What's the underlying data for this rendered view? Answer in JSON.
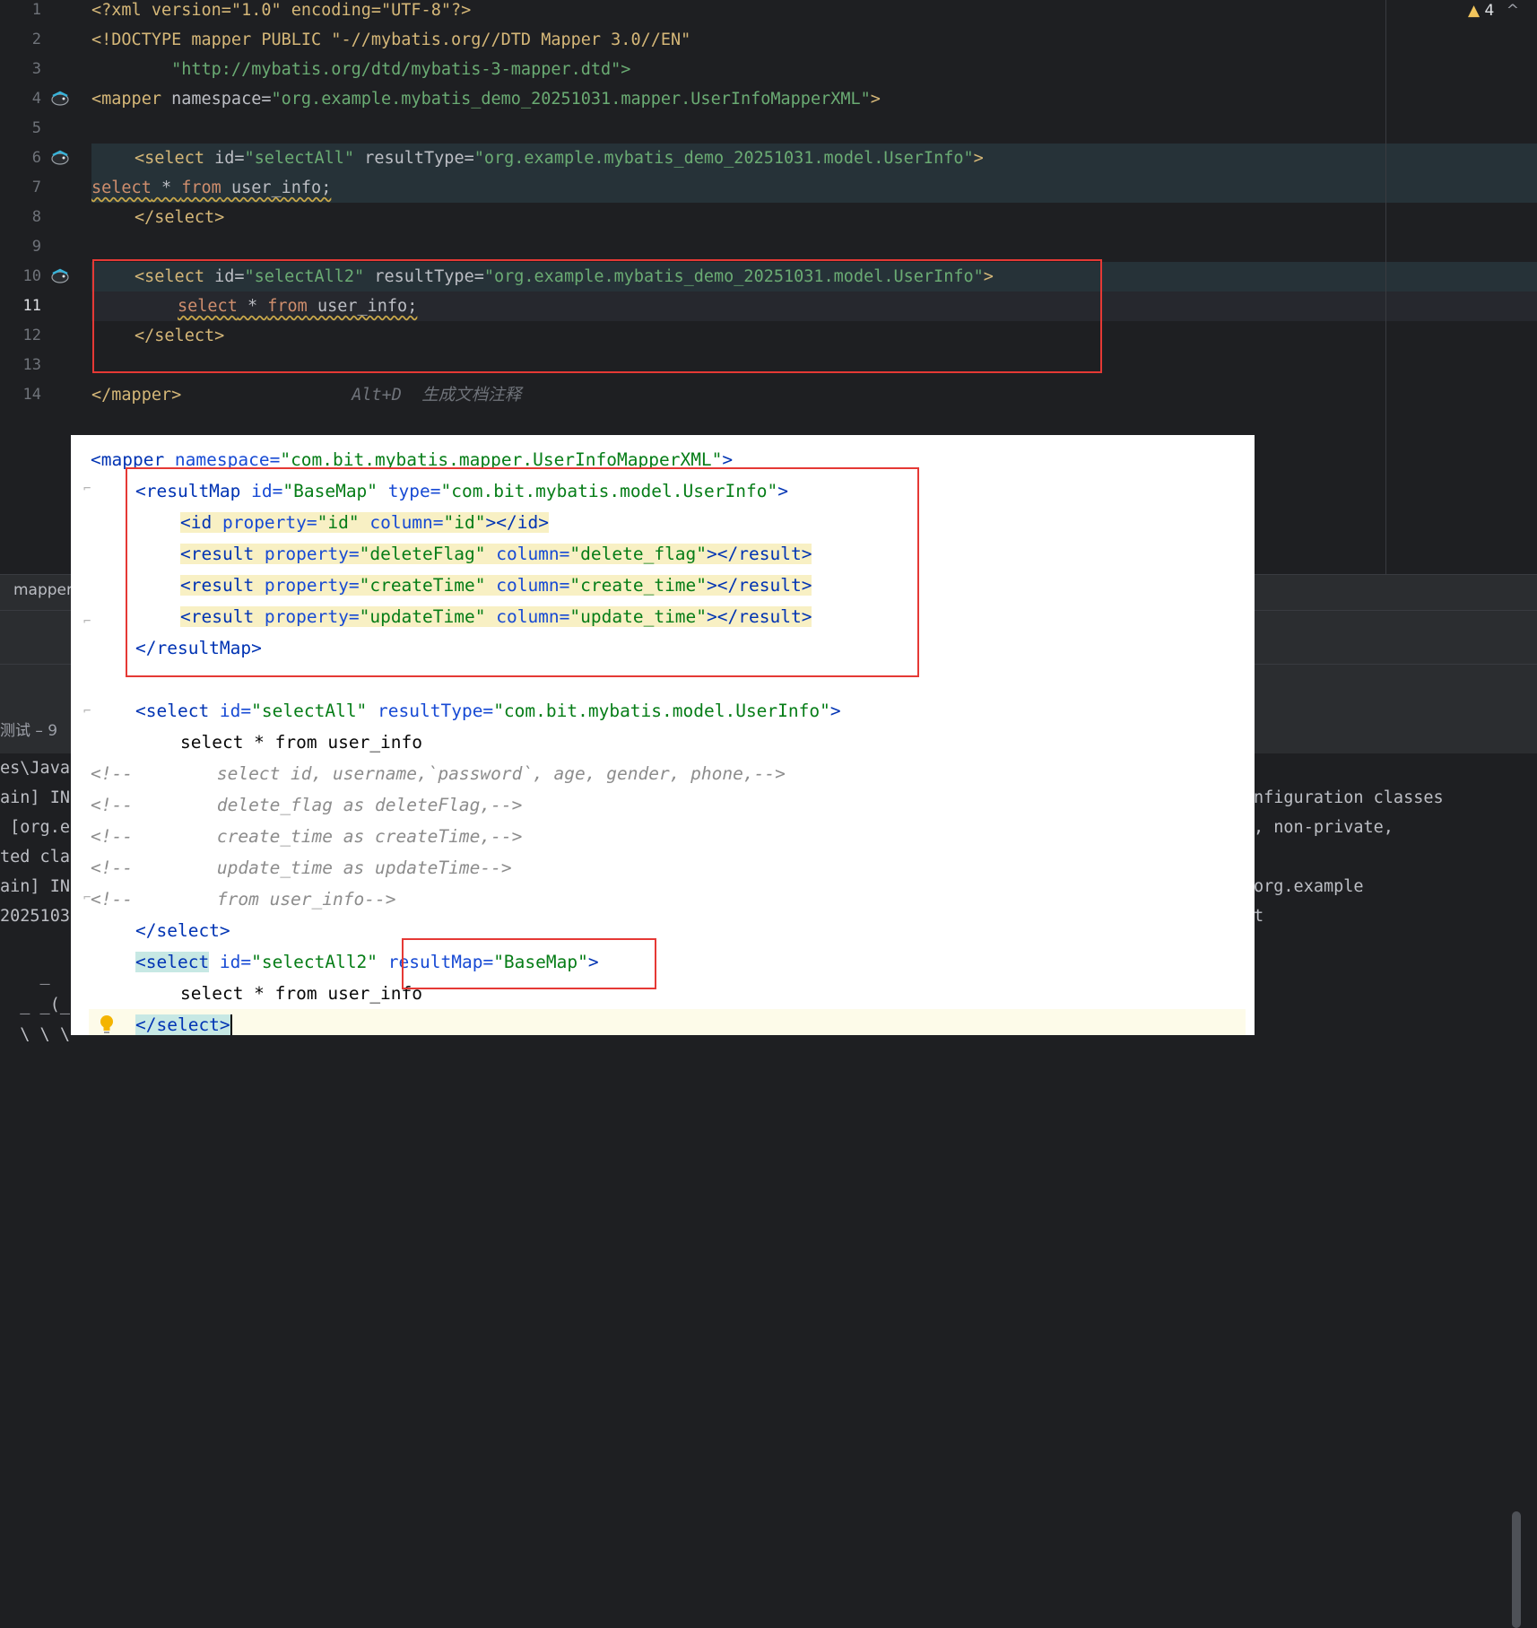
{
  "editor": {
    "inspection": {
      "icon": "warning-triangle-icon",
      "count": "4",
      "arrow": "^"
    },
    "line_numbers": [
      "1",
      "2",
      "3",
      "4",
      "5",
      "6",
      "7",
      "8",
      "9",
      "10",
      "11",
      "12",
      "13",
      "14"
    ],
    "lines": {
      "l1": "<?xml version=\"1.0\" encoding=\"UTF-8\"?>",
      "l2": "<!DOCTYPE mapper PUBLIC \"-//mybatis.org//DTD Mapper 3.0//EN\"",
      "l3": "        \"http://mybatis.org/dtd/mybatis-3-mapper.dtd\">",
      "l4": {
        "tag": "<mapper",
        "attr": " namespace=",
        "val": "\"org.example.mybatis_demo_20251031.mapper.UserInfoMapperXML\"",
        "end": ">"
      },
      "l6": {
        "tag": "<select",
        "attr1": " id=",
        "val1": "\"selectAll\"",
        "attr2": " resultType=",
        "val2": "\"org.example.mybatis_demo_20251031.model.UserInfo\"",
        "end": ">"
      },
      "l7": {
        "kw1": "select",
        "op": " * ",
        "kw2": "from",
        "rest": " user_info;"
      },
      "l8": "</select>",
      "l10": {
        "tag": "<select",
        "attr1": " id=",
        "val1": "\"selectAll2\"",
        "attr2": " resultType=",
        "val2": "\"org.example.mybatis_demo_20251031.model.UserInfo\"",
        "end": ">"
      },
      "l11": {
        "kw1": "select",
        "op": " * ",
        "kw2": "from",
        "rest": " user_info;"
      },
      "l12": "</select>",
      "l14": "</mapper>",
      "l14_hint": "Alt+D  生成文档注释"
    }
  },
  "bottom": {
    "tab_label": "mapper",
    "run_title": "测试 – 9",
    "console_left": [
      "es\\Java",
      "ain] IN",
      " [org.e",
      "ted cla",
      "ain] IN",
      "2025103",
      "",
      "    _",
      "  _ _(_)",
      "  \\ \\ \\"
    ],
    "console_right": [
      "nfiguration classes",
      ", non-private,",
      "",
      "org.example",
      "t"
    ]
  },
  "overlay": {
    "l1": {
      "tag": "<mapper",
      "attr": " namespace=",
      "val": "\"com.bit.mybatis.mapper.UserInfoMapperXML\"",
      "end": ">"
    },
    "l2": {
      "tag": "<resultMap",
      "a1": " id=",
      "v1": "\"BaseMap\"",
      "a2": " type=",
      "v2": "\"com.bit.mybatis.model.UserInfo\"",
      "end": ">"
    },
    "l3": {
      "tag": "<id",
      "a1": " property=",
      "v1": "\"id\"",
      "a2": " column=",
      "v2": "\"id\"",
      "end": "></id>"
    },
    "l4": {
      "tag": "<result",
      "a1": " property=",
      "v1": "\"deleteFlag\"",
      "a2": " column=",
      "v2": "\"delete_flag\"",
      "end": "></result>"
    },
    "l5": {
      "tag": "<result",
      "a1": " property=",
      "v1": "\"createTime\"",
      "a2": " column=",
      "v2": "\"create_time\"",
      "end": "></result>"
    },
    "l6": {
      "tag": "<result",
      "a1": " property=",
      "v1": "\"updateTime\"",
      "a2": " column=",
      "v2": "\"update_time\"",
      "end": "></result>"
    },
    "l7": "</resultMap>",
    "l8": {
      "tag": "<select",
      "a1": " id=",
      "v1": "\"selectAll\"",
      "a2": " resultType=",
      "v2": "\"com.bit.mybatis.model.UserInfo\"",
      "end": ">"
    },
    "l9": "select * from user_info",
    "comments": [
      "<!--        select id, username,`password`, age, gender, phone,-->",
      "<!--        delete_flag as deleteFlag,-->",
      "<!--        create_time as createTime,-->",
      "<!--        update_time as updateTime-->",
      "<!--        from user_info-->"
    ],
    "l15": "</select>",
    "l16": {
      "tag": "<select",
      "a1": " id=",
      "v1": "\"selectAll2\"",
      "a2": " resultMap=",
      "v2": "\"BaseMap\"",
      "end": ">"
    },
    "l17": "select * from user_info",
    "l18": "</select>"
  }
}
